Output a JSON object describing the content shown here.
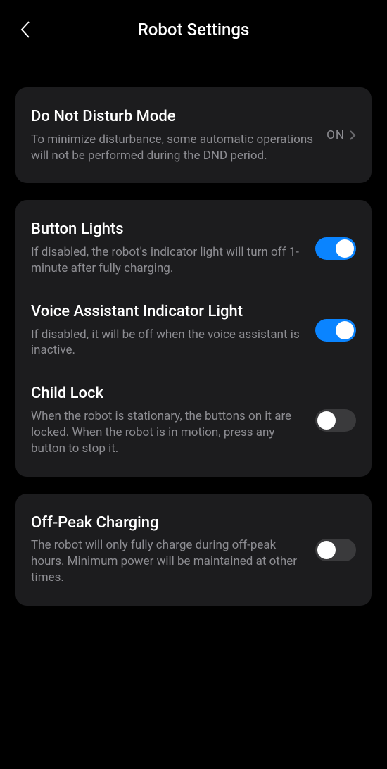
{
  "header": {
    "title": "Robot Settings"
  },
  "groups": [
    {
      "items": [
        {
          "id": "dnd",
          "title": "Do Not Disturb Mode",
          "desc": "To minimize disturbance, some automatic operations will not be performed during the DND period.",
          "control": "nav",
          "value": "ON"
        }
      ]
    },
    {
      "items": [
        {
          "id": "button-lights",
          "title": "Button Lights",
          "desc": "If disabled, the robot's indicator light will turn off 1-minute after fully charging.",
          "control": "toggle",
          "state": "on"
        },
        {
          "id": "voice-assistant-light",
          "title": "Voice Assistant Indicator Light",
          "desc": "If disabled, it will be off when the voice assistant is inactive.",
          "control": "toggle",
          "state": "on"
        },
        {
          "id": "child-lock",
          "title": "Child Lock",
          "desc": "When the robot is stationary, the buttons on it are locked. When the robot is in motion, press any button to stop it.",
          "control": "toggle",
          "state": "off"
        }
      ]
    },
    {
      "items": [
        {
          "id": "off-peak-charging",
          "title": "Off-Peak Charging",
          "desc": "The robot will only fully charge during off-peak hours. Minimum power will be maintained at other times.",
          "control": "toggle",
          "state": "off"
        }
      ]
    }
  ]
}
